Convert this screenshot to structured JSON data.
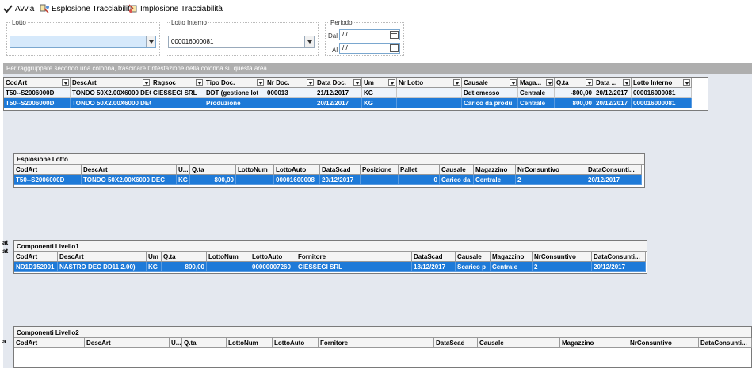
{
  "toolbar": {
    "avvia": "Avvia",
    "esplosione": "Esplosione Tracciabilità",
    "implosione": "Implosione Tracciabilità"
  },
  "filters": {
    "lotto_label": "Lotto",
    "lotto_value": "",
    "lotto_interno_label": "Lotto Interno",
    "lotto_interno_value": "000016000081",
    "periodo_label": "Periodo",
    "dal_label": "Dal",
    "dal_value": "/ /",
    "al_label": "Al",
    "al_value": "/ /"
  },
  "group_hint": "Per raggruppare secondo una colonna, trascinare l'intestazione della colonna su questa area",
  "main_grid": {
    "columns": [
      "CodArt",
      "DescArt",
      "Ragsoc",
      "Tipo Doc.",
      "Nr Doc.",
      "Data Doc.",
      "Um",
      "Nr Lotto",
      "Causale",
      "Maga...",
      "Q.ta",
      "Data ...",
      "Lotto Interno"
    ],
    "rows": [
      [
        "T50--S2006000D",
        "TONDO 50X2.00X6000 DEC",
        "CIESSECI SRL",
        "DDT (gestione lot",
        "000013",
        "21/12/2017",
        "KG",
        "",
        "Ddt emesso",
        "Centrale",
        "-800,00",
        "20/12/2017",
        "000016000081"
      ],
      [
        "T50--S2006000D",
        "TONDO 50X2.00X6000 DEC",
        "",
        "Produzione",
        "",
        "20/12/2017",
        "KG",
        "",
        "Carico da produ",
        "Centrale",
        "800,00",
        "20/12/2017",
        "000016000081"
      ]
    ]
  },
  "esplosione": {
    "title": "Esplosione Lotto",
    "columns": [
      "CodArt",
      "DescArt",
      "U...",
      "Q.ta",
      "LottoNum",
      "LottoAuto",
      "DataScad",
      "Posizione",
      "Pallet",
      "Causale",
      "Magazzino",
      "NrConsuntivo",
      "DataConsunti..."
    ],
    "rows": [
      [
        "T50--S2006000D",
        "TONDO 50X2.00X6000 DEC",
        "KG",
        "800,00",
        "",
        "00001600008",
        "20/12/2017",
        "",
        "0",
        "Carico da",
        "Centrale",
        "2",
        "20/12/2017"
      ]
    ]
  },
  "livello1": {
    "title": "Componenti Livello1",
    "columns": [
      "CodArt",
      "DescArt",
      "Um",
      "Q.ta",
      "LottoNum",
      "LottoAuto",
      "Fornitore",
      "DataScad",
      "Causale",
      "Magazzino",
      "NrConsuntivo",
      "DataConsunti..."
    ],
    "rows": [
      [
        "ND1D152001",
        "NASTRO DEC DD11 2.00)",
        "KG",
        "800,00",
        "",
        "00000007260",
        "CIESSEGI SRL",
        "18/12/2017",
        "Scarico p",
        "Centrale",
        "2",
        "20/12/2017"
      ]
    ]
  },
  "livello2": {
    "title": "Componenti Livello2",
    "columns": [
      "CodArt",
      "DescArt",
      "U...",
      "Q.ta",
      "LottoNum",
      "LottoAuto",
      "Fornitore",
      "DataScad",
      "Causale",
      "Magazzino",
      "NrConsuntivo",
      "DataConsunti..."
    ]
  },
  "side_marks": [
    "at",
    "at",
    "a"
  ],
  "colors": {
    "selection": "#1e7ad8",
    "header": "#f4f4f4",
    "group_area": "#aeaeae",
    "panel_bg": "#e4e8ef"
  }
}
